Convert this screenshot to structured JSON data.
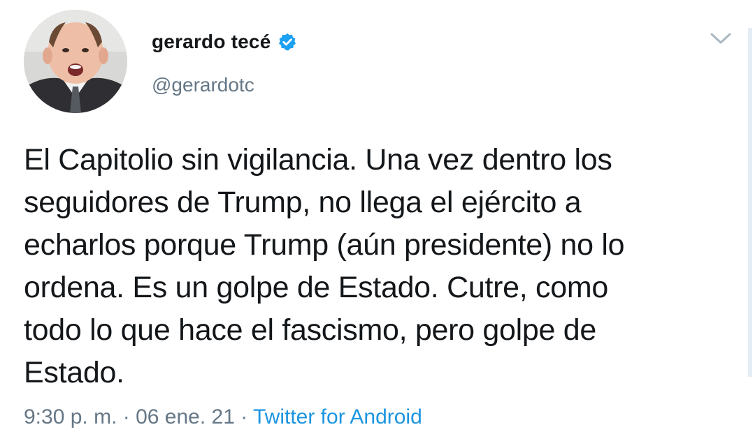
{
  "user": {
    "display_name": "gerardo tecé",
    "handle": "@gerardotc",
    "verified": true
  },
  "tweet": {
    "text": "El Capitolio sin vigilancia. Una vez dentro los\nseguidores de Trump, no llega el ejército a\necharlos porque Trump (aún presidente) no lo\nordena. Es un golpe de Estado. Cutre, como\ntodo lo que hace el fascismo, pero golpe de\nEstado."
  },
  "meta": {
    "time": "9:30 p. m.",
    "separator_1": " · ",
    "date": "06 ene. 21",
    "separator_2": " · ",
    "source": "Twitter for Android"
  },
  "icons": {
    "verified": "verified-badge-icon",
    "menu": "chevron-down-icon"
  },
  "colors": {
    "text": "#14171a",
    "secondary": "#657786",
    "link": "#1b95e0",
    "verified": "#1da1f2"
  }
}
